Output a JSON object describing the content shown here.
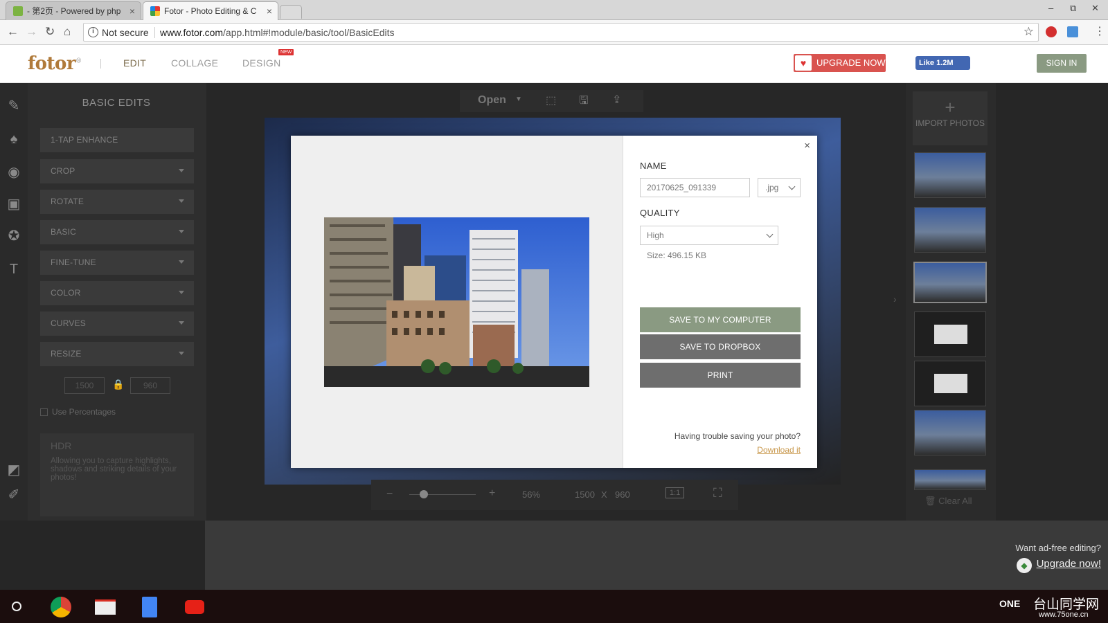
{
  "browser": {
    "tabs": [
      {
        "title": "- 第2页 - Powered by php"
      },
      {
        "title": "Fotor - Photo Editing & C"
      }
    ],
    "security": "Not secure",
    "url_host": "www.fotor.com",
    "url_path": "/app.html#!module/basic/tool/BasicEdits"
  },
  "header": {
    "logo": "fotor",
    "nav": [
      "EDIT",
      "COLLAGE",
      "DESIGN"
    ],
    "new_badge": "NEW",
    "upgrade": "UPGRADE NOW",
    "fb_like": "Like 1.2M",
    "sign_in": "SIGN IN"
  },
  "left_panel": {
    "title": "BASIC EDITS",
    "items": [
      "1-TAP ENHANCE",
      "CROP",
      "ROTATE",
      "BASIC",
      "FINE-TUNE",
      "COLOR",
      "CURVES",
      "RESIZE"
    ],
    "resize_w": "1500",
    "resize_h": "960",
    "use_percentages": "Use Percentages",
    "hdr_title": "HDR",
    "hdr_desc": "Allowing you to capture highlights, shadows and striking details of your photos!"
  },
  "canvas": {
    "open": "Open",
    "zoom": "56%",
    "width": "1500",
    "x": "X",
    "height": "960",
    "one_to_one": "1:1"
  },
  "right_panel": {
    "import": "IMPORT PHOTOS",
    "clear_all": "Clear All"
  },
  "dialog": {
    "name_label": "NAME",
    "name_value": "20170625_091339",
    "ext": ".jpg",
    "quality_label": "QUALITY",
    "quality": "High",
    "size": "Size: 496.15 KB",
    "save_computer": "SAVE TO MY  COMPUTER",
    "save_dropbox": "SAVE TO DROPBOX",
    "print": "PRINT",
    "trouble": "Having trouble saving your photo?",
    "download": "Download it",
    "close": "×",
    "colors": {
      "save_computer": "#8a9a82",
      "save_dropbox": "#6e6e6e",
      "print": "#6e6e6e"
    }
  },
  "promo": {
    "ad_free": "Want ad-free editing?",
    "upgrade_link": "Upgrade now!"
  },
  "watermark": {
    "brand": "ONE",
    "site": "台山同学网",
    "url": "www.75one.cn"
  }
}
